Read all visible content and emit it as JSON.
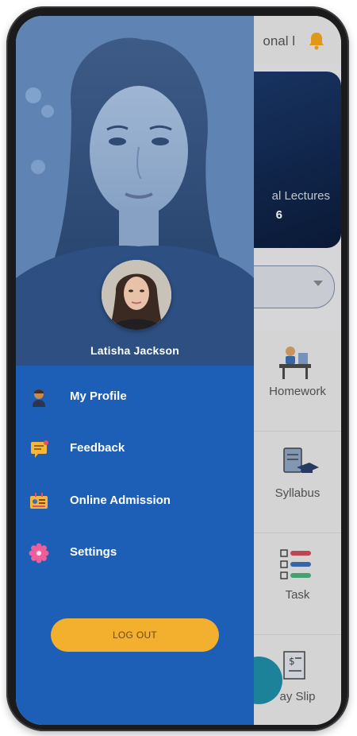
{
  "background": {
    "header_title": "onal l",
    "lectures": {
      "label": "al Lectures",
      "value": "6"
    },
    "tiles": [
      {
        "label": "Homework",
        "icon": "homework-icon"
      },
      {
        "label": "Syllabus",
        "icon": "syllabus-icon"
      },
      {
        "label": "Task",
        "icon": "task-icon"
      },
      {
        "label": "ay Slip",
        "icon": "payslip-icon"
      }
    ]
  },
  "drawer": {
    "user_name": "Latisha Jackson",
    "menu": [
      {
        "label": "My Profile",
        "icon": "profile-icon"
      },
      {
        "label": "Feedback",
        "icon": "feedback-icon"
      },
      {
        "label": "Online Admission",
        "icon": "admission-icon"
      },
      {
        "label": "Settings",
        "icon": "settings-icon"
      }
    ],
    "logout_label": "LOG OUT"
  },
  "colors": {
    "drawer": "#1d5fb7",
    "logout": "#f2b02e",
    "bell": "#f2a51c",
    "fab": "#1e8ea8"
  }
}
